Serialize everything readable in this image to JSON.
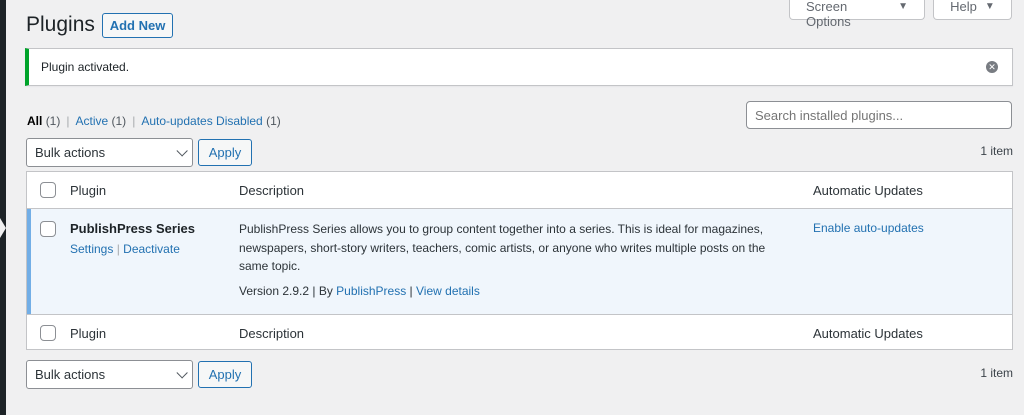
{
  "header": {
    "title": "Plugins",
    "add_new_label": "Add New",
    "screen_options_label": "Screen Options",
    "help_label": "Help"
  },
  "notice": {
    "text": "Plugin activated.",
    "type": "success",
    "color": "#00a32a"
  },
  "filters": {
    "all_label": "All",
    "all_count": "(1)",
    "active_label": "Active",
    "active_count": "(1)",
    "auto_updates_disabled_label": "Auto-updates Disabled",
    "auto_updates_disabled_count": "(1)",
    "separator": "|"
  },
  "search": {
    "placeholder": "Search installed plugins..."
  },
  "tablenav": {
    "bulk_actions_label": "Bulk actions",
    "apply_label": "Apply",
    "item_count": "1 item"
  },
  "table": {
    "columns": {
      "plugin": "Plugin",
      "description": "Description",
      "automatic_updates": "Automatic Updates"
    },
    "rows": [
      {
        "name": "PublishPress Series",
        "actions": [
          "Settings",
          "Deactivate"
        ],
        "action_separator": "|",
        "description": "PublishPress Series allows you to group content together into a series. This is ideal for magazines, newspapers, short-story writers, teachers, comic artists, or anyone who writes multiple posts on the same topic.",
        "version_prefix": "Version 2.9.2 | By ",
        "author": "PublishPress",
        "meta_separator": "|",
        "view_details": "View details",
        "auto_update_action": "Enable auto-updates",
        "active": true
      }
    ]
  },
  "colors": {
    "link": "#2271b1",
    "active_row_bg": "#f0f6fc",
    "active_row_border": "#72aee6",
    "page_bg": "#f0f0f1"
  },
  "icons": {
    "dismiss": "close-circle-icon",
    "dropdown": "chevron-down-icon",
    "caret": "caret-down-icon"
  }
}
